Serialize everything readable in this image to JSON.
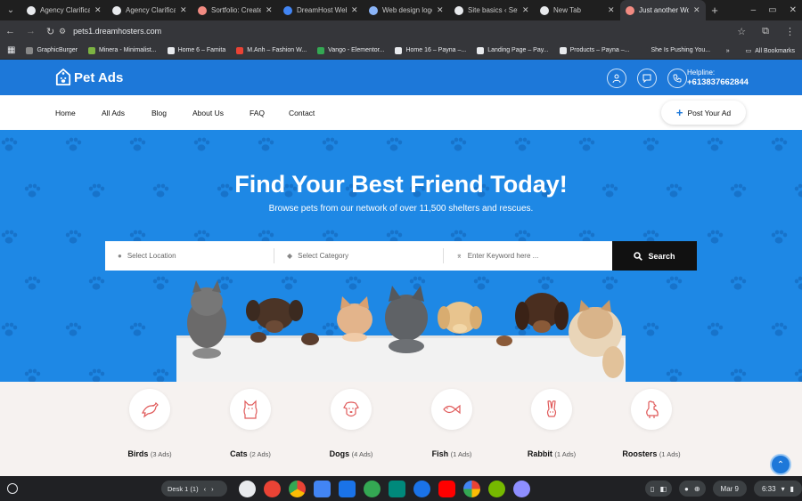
{
  "browser": {
    "tabs": [
      {
        "title": "Agency Clarificatio",
        "favicon_color": "#e8eaed"
      },
      {
        "title": "Agency Clarificatio",
        "favicon_color": "#e8eaed"
      },
      {
        "title": "Sortfolio: Create yo",
        "favicon_color": "#f28b82"
      },
      {
        "title": "DreamHost Webm",
        "favicon_color": "#4285f4"
      },
      {
        "title": "Web design logo -",
        "favicon_color": "#8ab4f8"
      },
      {
        "title": "Site basics ‹ Setting",
        "favicon_color": "#e8eaed"
      },
      {
        "title": "New Tab",
        "favicon_color": "#e8eaed"
      },
      {
        "title": "Just another Word",
        "favicon_color": "#f28b82",
        "active": true
      }
    ],
    "url": "pets1.dreamhosters.com",
    "bookmarks": [
      {
        "label": "GraphicBurger",
        "color": "#888888"
      },
      {
        "label": "Minera - Minimalist...",
        "color": "#7cb342"
      },
      {
        "label": "Home 6 – Famita",
        "color": "#e8eaed"
      },
      {
        "label": "M.Anh – Fashion W...",
        "color": "#ea4335"
      },
      {
        "label": "Vango - Elementor...",
        "color": "#34a853"
      },
      {
        "label": "Home 16 – Payna –...",
        "color": "#e8eaed"
      },
      {
        "label": "Landing Page – Pay...",
        "color": "#e8eaed"
      },
      {
        "label": "Products – Payna –...",
        "color": "#e8eaed"
      },
      {
        "label": "She Is Pushing You...",
        "color": "#35363a"
      }
    ],
    "bookmarks_overflow": "»",
    "all_bookmarks": "All Bookmarks"
  },
  "site": {
    "logo": "Pet Ads",
    "helpline_label": "Helpline:",
    "helpline_number": "+613837662844",
    "nav": [
      "Home",
      "All Ads",
      "Blog",
      "About Us",
      "FAQ",
      "Contact"
    ],
    "post_ad": "Post Your Ad",
    "hero_title": "Find Your Best Friend Today!",
    "hero_subtitle": "Browse pets from our network of over 11,500 shelters and rescues.",
    "search": {
      "location_placeholder": "Select Location",
      "category_placeholder": "Select Category",
      "keyword_placeholder": "Enter Keyword here ...",
      "button": "Search"
    },
    "categories": [
      {
        "name": "Birds",
        "count": "(3 Ads)"
      },
      {
        "name": "Cats",
        "count": "(2 Ads)"
      },
      {
        "name": "Dogs",
        "count": "(4 Ads)"
      },
      {
        "name": "Fish",
        "count": "(1 Ads)"
      },
      {
        "name": "Rabbit",
        "count": "(1 Ads)"
      },
      {
        "name": "Roosters",
        "count": "(1 Ads)"
      }
    ]
  },
  "shelf": {
    "desk": "Desk 1 (1)",
    "date": "Mar 9",
    "time": "6:33"
  },
  "colors": {
    "brand_blue": "#1d78d9",
    "hero_blue": "#1e88e5",
    "icon_red": "#e05a5a"
  }
}
